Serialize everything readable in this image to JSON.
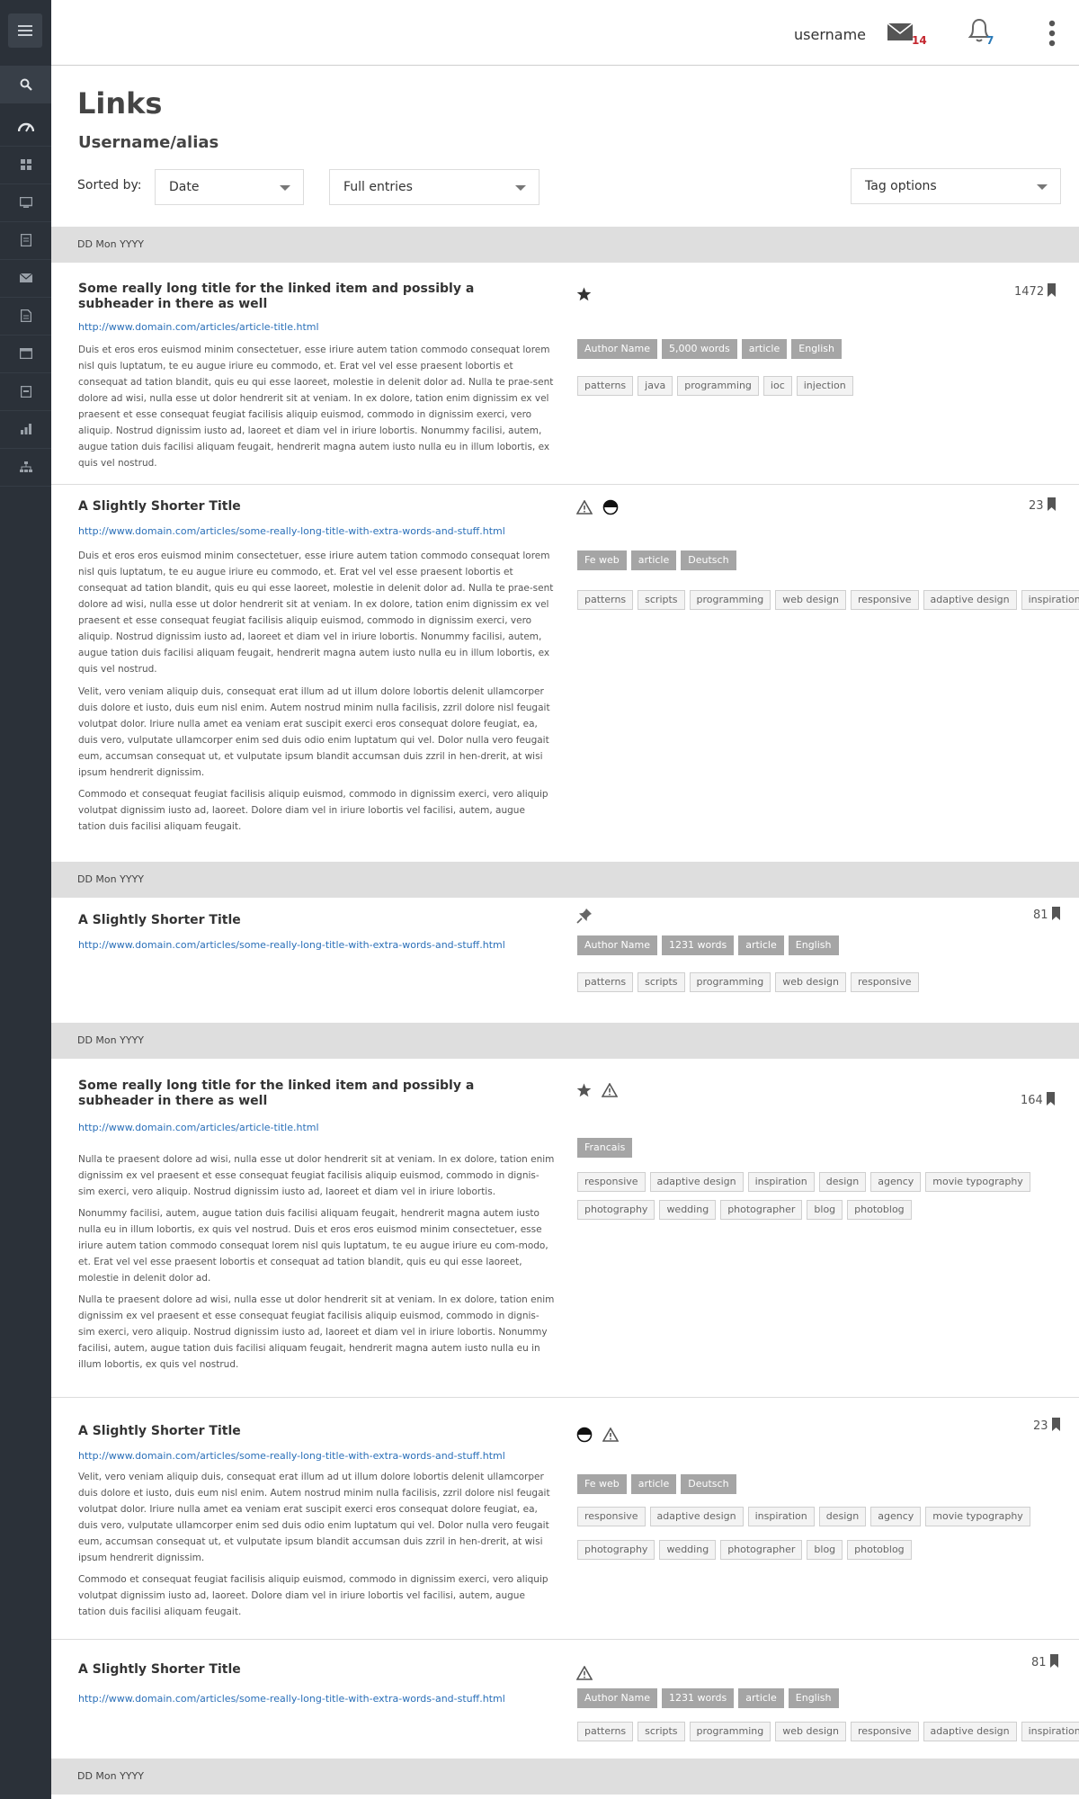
{
  "header": {
    "username": "username",
    "mail_count": "14",
    "notification_count": "7"
  },
  "page": {
    "title": "Links",
    "subtitle": "Username/alias",
    "sorted_by_label": "Sorted by:",
    "sort_select": "Date",
    "entries_select": "Full entries",
    "tag_options_select": "Tag options"
  },
  "date_label": "DD Mon YYYY",
  "sidebar": {
    "items": [
      "menu-icon",
      "search-icon",
      "dashboard-icon",
      "grid-icon",
      "monitor-icon",
      "page-icon",
      "mail-icon",
      "document-icon",
      "browser-window-icon",
      "archive-box-icon",
      "bar-chart-icon",
      "sitemap-icon"
    ]
  },
  "entries": [
    {
      "title": "Some really long title for the linked item and possibly a subheader in there as well",
      "url": "http://www.domain.com/articles/article-title.html",
      "paragraphs": [
        "Duis et eros eros euismod minim consectetuer, esse iriure autem tation commodo consequat lorem nisl quis luptatum, te eu augue iriure eu commodo, et. Erat vel vel esse praesent lobortis et consequat ad tation blandit, quis eu qui esse laoreet, molestie in delenit dolor ad. Nulla te prae-sent dolore ad wisi, nulla esse ut dolor hendrerit sit at veniam. In ex dolore, tation enim dignissim ex vel praesent et esse consequat feugiat facilisis aliquip euismod, commodo in dignissim exerci, vero aliquip. Nostrud dignissim iusto ad, laoreet et diam vel in iriure lobortis. Nonummy facilisi, autem, augue tation duis facilisi aliquam feugait, hendrerit magna autem iusto nulla eu in illum lobortis, ex quis vel nostrud."
      ],
      "icons": [
        "star-icon"
      ],
      "count": "1472",
      "tag_rows": [
        {
          "style": "dark",
          "tags": [
            "Author Name",
            "5,000 words",
            "article",
            "English"
          ]
        },
        {
          "style": "light",
          "tags": [
            "patterns",
            "java",
            "programming",
            "ioc",
            "injection"
          ]
        }
      ]
    },
    {
      "title": "A Slightly Shorter Title",
      "url": "http://www.domain.com/articles/some-really-long-title-with-extra-words-and-stuff.html",
      "paragraphs": [
        "Duis et eros eros euismod minim consectetuer, esse iriure autem tation commodo consequat lorem nisl quis luptatum, te eu augue iriure eu commodo, et. Erat vel vel esse praesent lobortis et consequat ad tation blandit, quis eu qui esse laoreet, molestie in delenit dolor ad. Nulla te prae-sent dolore ad wisi, nulla esse ut dolor hendrerit sit at veniam. In ex dolore, tation enim dignissim ex vel praesent et esse consequat feugiat facilisis aliquip euismod, commodo in dignissim exerci, vero aliquip. Nostrud dignissim iusto ad, laoreet et diam vel in iriure lobortis. Nonummy facilisi, autem, augue tation duis facilisi aliquam feugait, hendrerit magna autem iusto nulla eu in illum lobortis, ex quis vel nostrud.",
        "Velit, vero veniam aliquip duis, consequat erat illum ad ut illum dolore lobortis delenit ullamcorper duis dolore et iusto, duis eum nisl enim. Autem nostrud minim nulla facilisis, zzril dolore nisl feugait volutpat dolor. Iriure nulla amet ea veniam erat suscipit exerci eros consequat dolore feugiat, ea, duis vero, vulputate ullamcorper enim sed duis odio enim luptatum qui vel. Dolor nulla vero feugait eum, accumsan consequat ut, et vulputate ipsum blandit accumsan duis zzril in hen-drerit, at wisi ipsum hendrerit dignissim.",
        "Commodo et consequat feugiat facilisis aliquip euismod, commodo in dignissim exerci, vero aliquip volutpat dignissim iusto ad, laoreet. Dolore diam vel in iriure lobortis vel facilisi, autem, augue tation duis facilisi aliquam feugait."
      ],
      "icons": [
        "warning-icon",
        "half-circle-icon"
      ],
      "count": "23",
      "tag_rows": [
        {
          "style": "dark",
          "tags": [
            "Fe web",
            "article",
            "Deutsch"
          ]
        },
        {
          "style": "light",
          "tags": [
            "patterns",
            "scripts",
            "programming",
            "web design",
            "responsive",
            "adaptive design",
            "inspiration"
          ]
        }
      ]
    },
    {
      "title": "A Slightly Shorter Title",
      "url": "http://www.domain.com/articles/some-really-long-title-with-extra-words-and-stuff.html",
      "paragraphs": [],
      "icons": [
        "pin-icon"
      ],
      "count": "81",
      "tag_rows": [
        {
          "style": "dark",
          "tags": [
            "Author Name",
            "1231 words",
            "article",
            "English"
          ]
        },
        {
          "style": "light",
          "tags": [
            "patterns",
            "scripts",
            "programming",
            "web design",
            "responsive"
          ]
        }
      ]
    },
    {
      "title": "Some really long title for the linked item and possibly a subheader in there as well",
      "url": "http://www.domain.com/articles/article-title.html",
      "paragraphs": [
        "Nulla te praesent dolore ad wisi, nulla esse ut dolor hendrerit sit at veniam. In ex dolore, tation enim dignissim ex vel praesent et esse consequat feugiat facilisis aliquip euismod, commodo in dignis-sim exerci, vero aliquip. Nostrud dignissim iusto ad, laoreet et diam vel in iriure lobortis.",
        "Nonummy facilisi, autem, augue tation duis facilisi aliquam feugait, hendrerit magna autem iusto nulla eu in illum lobortis, ex quis vel nostrud. Duis et eros eros euismod minim consectetuer, esse iriure autem tation commodo consequat lorem nisl quis luptatum, te eu augue iriure eu com-modo, et. Erat vel vel esse praesent lobortis et consequat ad tation blandit, quis eu qui esse laoreet, molestie in delenit dolor ad.",
        "Nulla te praesent dolore ad wisi, nulla esse ut dolor hendrerit sit at veniam. In ex dolore, tation enim dignissim ex vel praesent et esse consequat feugiat facilisis aliquip euismod, commodo in dignis-sim exerci, vero aliquip. Nostrud dignissim iusto ad, laoreet et diam vel in iriure lobortis. Nonummy facilisi, autem, augue tation duis facilisi aliquam feugait, hendrerit magna autem iusto nulla eu in illum lobortis, ex quis vel nostrud."
      ],
      "icons": [
        "star-icon",
        "warning-icon"
      ],
      "count": "164",
      "tag_rows": [
        {
          "style": "dark",
          "tags": [
            "Francais"
          ]
        },
        {
          "style": "light",
          "tags": [
            "responsive",
            "adaptive design",
            "inspiration",
            "design",
            "agency",
            "movie typography"
          ]
        },
        {
          "style": "light",
          "tags": [
            "photography",
            "wedding",
            "photographer",
            "blog",
            "photoblog"
          ]
        }
      ]
    },
    {
      "title": "A Slightly Shorter Title",
      "url": "http://www.domain.com/articles/some-really-long-title-with-extra-words-and-stuff.html",
      "paragraphs": [
        "Velit, vero veniam aliquip duis, consequat erat illum ad ut illum dolore lobortis delenit ullamcorper duis dolore et iusto, duis eum nisl enim. Autem nostrud minim nulla facilisis, zzril dolore nisl feugait volutpat dolor. Iriure nulla amet ea veniam erat suscipit exerci eros consequat dolore feugiat, ea, duis vero, vulputate ullamcorper enim sed duis odio enim luptatum qui vel. Dolor nulla vero feugait eum, accumsan consequat ut, et vulputate ipsum blandit accumsan duis zzril in hen-drerit, at wisi ipsum hendrerit dignissim.",
        "Commodo et consequat feugiat facilisis aliquip euismod, commodo in dignissim exerci, vero aliquip volutpat dignissim iusto ad, laoreet. Dolore diam vel in iriure lobortis vel facilisi, autem, augue tation duis facilisi aliquam feugait."
      ],
      "icons": [
        "half-circle-icon",
        "warning-icon"
      ],
      "count": "23",
      "tag_rows": [
        {
          "style": "dark",
          "tags": [
            "Fe web",
            "article",
            "Deutsch"
          ]
        },
        {
          "style": "light",
          "tags": [
            "responsive",
            "adaptive design",
            "inspiration",
            "design",
            "agency",
            "movie typography"
          ]
        },
        {
          "style": "light",
          "tags": [
            "photography",
            "wedding",
            "photographer",
            "blog",
            "photoblog"
          ]
        }
      ]
    },
    {
      "title": "A Slightly Shorter Title",
      "url": "http://www.domain.com/articles/some-really-long-title-with-extra-words-and-stuff.html",
      "paragraphs": [],
      "icons": [
        "warning-icon"
      ],
      "count": "81",
      "tag_rows": [
        {
          "style": "dark",
          "tags": [
            "Author Name",
            "1231 words",
            "article",
            "English"
          ]
        },
        {
          "style": "light",
          "tags": [
            "patterns",
            "scripts",
            "programming",
            "web design",
            "responsive",
            "adaptive design",
            "inspiration"
          ]
        }
      ]
    }
  ],
  "colors": {
    "sidebar": "#2b3139",
    "link": "#2a6fb8",
    "mail_badge": "#c4262e",
    "bell_badge": "#2a7ab8",
    "tag_dark": "#a5a5a5",
    "date_bar": "#dedede"
  }
}
